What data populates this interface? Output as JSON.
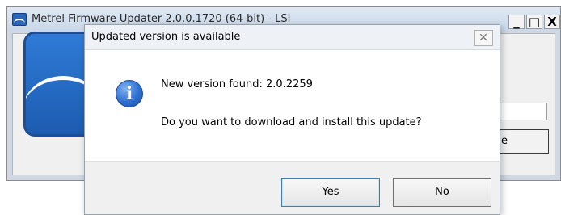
{
  "background_window": {
    "title": "Metrel Firmware Updater 2.0.0.1720 (64-bit) - LSI",
    "minimize_symbol": "_",
    "maximize_symbol": "□",
    "close_symbol": "X",
    "button_partial_label": "e"
  },
  "dialog": {
    "title": "Updated version is available",
    "close_symbol": "✕",
    "icon": "information-icon",
    "icon_glyph": "i",
    "message_line1": "New version found: 2.0.2259",
    "message_line2": "Do you want to download and install this update?",
    "buttons": {
      "yes": "Yes",
      "no": "No"
    }
  }
}
